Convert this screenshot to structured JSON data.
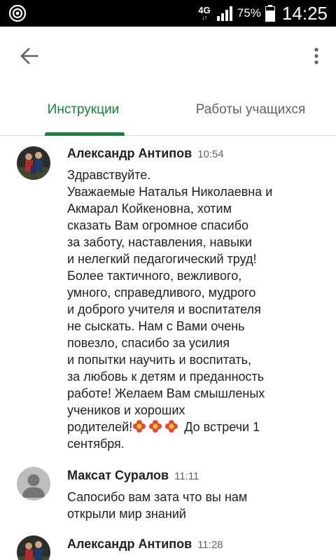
{
  "status_bar": {
    "network": "4G",
    "battery": "75%",
    "time": "14:25"
  },
  "app_bar": {
    "back_icon": "arrow-back-icon",
    "more_icon": "more-vert-icon"
  },
  "tabs": [
    {
      "label": "Инструкции",
      "active": true
    },
    {
      "label": "Работы учащихся",
      "active": false
    }
  ],
  "colors": {
    "accent": "#188038",
    "secondary_text": "#5f6368"
  },
  "comments": [
    {
      "author": "Александр Антипов",
      "time": "10:54",
      "lines": [
        "Здравствуйте.",
        "Уважаемые Наталья  Николаевна и",
        "Акмарал Койкеновна, хотим",
        "сказать Вам огромное спасибо",
        "за заботу, наставления, навыки",
        "и нелегкий педагогический труд!",
        "Более тактичного, вежливого,",
        "умного, справедливого, мудрого",
        "и доброго учителя и воспитателя",
        "не сыскать. Нам с Вами очень",
        "повезло, спасибо за усилия",
        "и попытки научить и воспитать,",
        "за любовь к детям и преданность",
        "работе! Желаем Вам смышленых",
        "учеников и хороших"
      ],
      "last_line_prefix": "родителей!",
      "last_line_suffix": " До встречи 1",
      "final_line": "сентября."
    },
    {
      "author": "Максат Суралов",
      "time": "11:11",
      "lines": [
        "Сапосибо вам зата что вы нам",
        "открыли мир знаний"
      ]
    },
    {
      "author": "Александр Антипов",
      "time": "11:28"
    }
  ]
}
